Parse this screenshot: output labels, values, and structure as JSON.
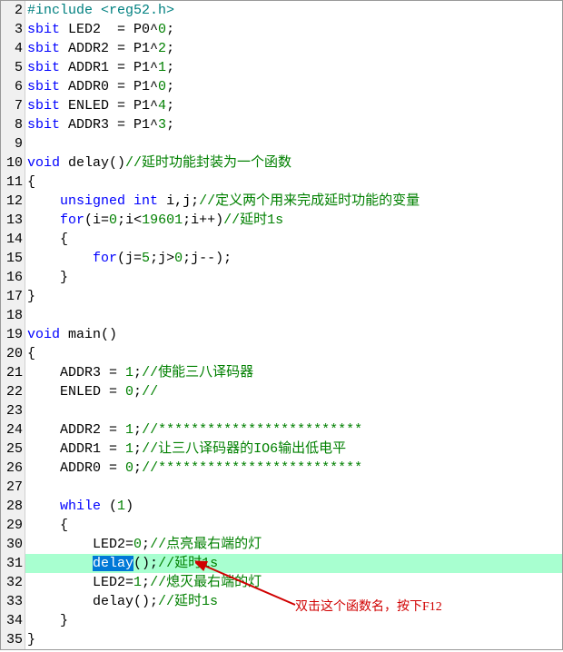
{
  "annotation": "双击这个函数名，按下F12",
  "lines": [
    {
      "n": 2,
      "segs": [
        {
          "t": "#include ",
          "c": "pp"
        },
        {
          "t": "<reg52.h>",
          "c": "pp"
        }
      ]
    },
    {
      "n": 3,
      "segs": [
        {
          "t": "sbit",
          "c": "kw"
        },
        {
          "t": " LED2  = P0^",
          "c": "tx"
        },
        {
          "t": "0",
          "c": "num"
        },
        {
          "t": ";",
          "c": "tx"
        }
      ]
    },
    {
      "n": 4,
      "segs": [
        {
          "t": "sbit",
          "c": "kw"
        },
        {
          "t": " ADDR2 = P1^",
          "c": "tx"
        },
        {
          "t": "2",
          "c": "num"
        },
        {
          "t": ";",
          "c": "tx"
        }
      ]
    },
    {
      "n": 5,
      "segs": [
        {
          "t": "sbit",
          "c": "kw"
        },
        {
          "t": " ADDR1 = P1^",
          "c": "tx"
        },
        {
          "t": "1",
          "c": "num"
        },
        {
          "t": ";",
          "c": "tx"
        }
      ]
    },
    {
      "n": 6,
      "segs": [
        {
          "t": "sbit",
          "c": "kw"
        },
        {
          "t": " ADDR0 = P1^",
          "c": "tx"
        },
        {
          "t": "0",
          "c": "num"
        },
        {
          "t": ";",
          "c": "tx"
        }
      ]
    },
    {
      "n": 7,
      "segs": [
        {
          "t": "sbit",
          "c": "kw"
        },
        {
          "t": " ENLED = P1^",
          "c": "tx"
        },
        {
          "t": "4",
          "c": "num"
        },
        {
          "t": ";",
          "c": "tx"
        }
      ]
    },
    {
      "n": 8,
      "segs": [
        {
          "t": "sbit",
          "c": "kw"
        },
        {
          "t": " ADDR3 = P1^",
          "c": "tx"
        },
        {
          "t": "3",
          "c": "num"
        },
        {
          "t": ";",
          "c": "tx"
        }
      ]
    },
    {
      "n": 9,
      "segs": []
    },
    {
      "n": 10,
      "segs": [
        {
          "t": "void",
          "c": "ty"
        },
        {
          "t": " delay()",
          "c": "tx"
        },
        {
          "t": "//延时功能封装为一个函数",
          "c": "cm"
        }
      ]
    },
    {
      "n": 11,
      "segs": [
        {
          "t": "{",
          "c": "tx"
        }
      ]
    },
    {
      "n": 12,
      "segs": [
        {
          "t": "    ",
          "c": "tx"
        },
        {
          "t": "unsigned",
          "c": "ty"
        },
        {
          "t": " ",
          "c": "tx"
        },
        {
          "t": "int",
          "c": "ty"
        },
        {
          "t": " i,j;",
          "c": "tx"
        },
        {
          "t": "//定义两个用来完成延时功能的变量",
          "c": "cm"
        }
      ]
    },
    {
      "n": 13,
      "segs": [
        {
          "t": "    ",
          "c": "tx"
        },
        {
          "t": "for",
          "c": "kw"
        },
        {
          "t": "(i=",
          "c": "tx"
        },
        {
          "t": "0",
          "c": "num"
        },
        {
          "t": ";i<",
          "c": "tx"
        },
        {
          "t": "19601",
          "c": "num"
        },
        {
          "t": ";i++)",
          "c": "tx"
        },
        {
          "t": "//延时1s",
          "c": "cm"
        }
      ]
    },
    {
      "n": 14,
      "segs": [
        {
          "t": "    {",
          "c": "tx"
        }
      ]
    },
    {
      "n": 15,
      "segs": [
        {
          "t": "        ",
          "c": "tx"
        },
        {
          "t": "for",
          "c": "kw"
        },
        {
          "t": "(j=",
          "c": "tx"
        },
        {
          "t": "5",
          "c": "num"
        },
        {
          "t": ";j>",
          "c": "tx"
        },
        {
          "t": "0",
          "c": "num"
        },
        {
          "t": ";j--);",
          "c": "tx"
        }
      ]
    },
    {
      "n": 16,
      "segs": [
        {
          "t": "    }",
          "c": "tx"
        }
      ]
    },
    {
      "n": 17,
      "segs": [
        {
          "t": "}",
          "c": "tx"
        }
      ]
    },
    {
      "n": 18,
      "segs": []
    },
    {
      "n": 19,
      "segs": [
        {
          "t": "void",
          "c": "ty"
        },
        {
          "t": " main()",
          "c": "tx"
        }
      ]
    },
    {
      "n": 20,
      "segs": [
        {
          "t": "{",
          "c": "tx"
        }
      ]
    },
    {
      "n": 21,
      "segs": [
        {
          "t": "    ADDR3 = ",
          "c": "tx"
        },
        {
          "t": "1",
          "c": "num"
        },
        {
          "t": ";",
          "c": "tx"
        },
        {
          "t": "//使能三八译码器",
          "c": "cm"
        }
      ]
    },
    {
      "n": 22,
      "segs": [
        {
          "t": "    ENLED = ",
          "c": "tx"
        },
        {
          "t": "0",
          "c": "num"
        },
        {
          "t": ";",
          "c": "tx"
        },
        {
          "t": "//",
          "c": "cm"
        }
      ]
    },
    {
      "n": 23,
      "segs": []
    },
    {
      "n": 24,
      "segs": [
        {
          "t": "    ADDR2 = ",
          "c": "tx"
        },
        {
          "t": "1",
          "c": "num"
        },
        {
          "t": ";",
          "c": "tx"
        },
        {
          "t": "//*************************",
          "c": "cm"
        }
      ]
    },
    {
      "n": 25,
      "segs": [
        {
          "t": "    ADDR1 = ",
          "c": "tx"
        },
        {
          "t": "1",
          "c": "num"
        },
        {
          "t": ";",
          "c": "tx"
        },
        {
          "t": "//让三八译码器的IO6输出低电平",
          "c": "cm"
        }
      ]
    },
    {
      "n": 26,
      "segs": [
        {
          "t": "    ADDR0 = ",
          "c": "tx"
        },
        {
          "t": "0",
          "c": "num"
        },
        {
          "t": ";",
          "c": "tx"
        },
        {
          "t": "//*************************",
          "c": "cm"
        }
      ]
    },
    {
      "n": 27,
      "segs": []
    },
    {
      "n": 28,
      "segs": [
        {
          "t": "    ",
          "c": "tx"
        },
        {
          "t": "while",
          "c": "kw"
        },
        {
          "t": " (",
          "c": "tx"
        },
        {
          "t": "1",
          "c": "num"
        },
        {
          "t": ")",
          "c": "tx"
        }
      ]
    },
    {
      "n": 29,
      "segs": [
        {
          "t": "    {",
          "c": "tx"
        }
      ]
    },
    {
      "n": 30,
      "segs": [
        {
          "t": "        LED2=",
          "c": "tx"
        },
        {
          "t": "0",
          "c": "num"
        },
        {
          "t": ";",
          "c": "tx"
        },
        {
          "t": "//点亮最右端的灯",
          "c": "cm"
        }
      ]
    },
    {
      "n": 31,
      "hl": true,
      "segs": [
        {
          "t": "        ",
          "c": "tx"
        },
        {
          "t": "delay",
          "c": "sel"
        },
        {
          "t": "()",
          "c": "tx"
        },
        {
          "t": ";",
          "c": "tx"
        },
        {
          "t": "//延时1s",
          "c": "cm"
        }
      ]
    },
    {
      "n": 32,
      "segs": [
        {
          "t": "        LED2=",
          "c": "tx"
        },
        {
          "t": "1",
          "c": "num"
        },
        {
          "t": ";",
          "c": "tx"
        },
        {
          "t": "//熄灭最右端的灯",
          "c": "cm"
        }
      ]
    },
    {
      "n": 33,
      "segs": [
        {
          "t": "        delay();",
          "c": "tx"
        },
        {
          "t": "//延时1s",
          "c": "cm"
        }
      ]
    },
    {
      "n": 34,
      "segs": [
        {
          "t": "    }",
          "c": "tx"
        }
      ]
    },
    {
      "n": 35,
      "segs": [
        {
          "t": "}",
          "c": "tx"
        }
      ]
    }
  ]
}
